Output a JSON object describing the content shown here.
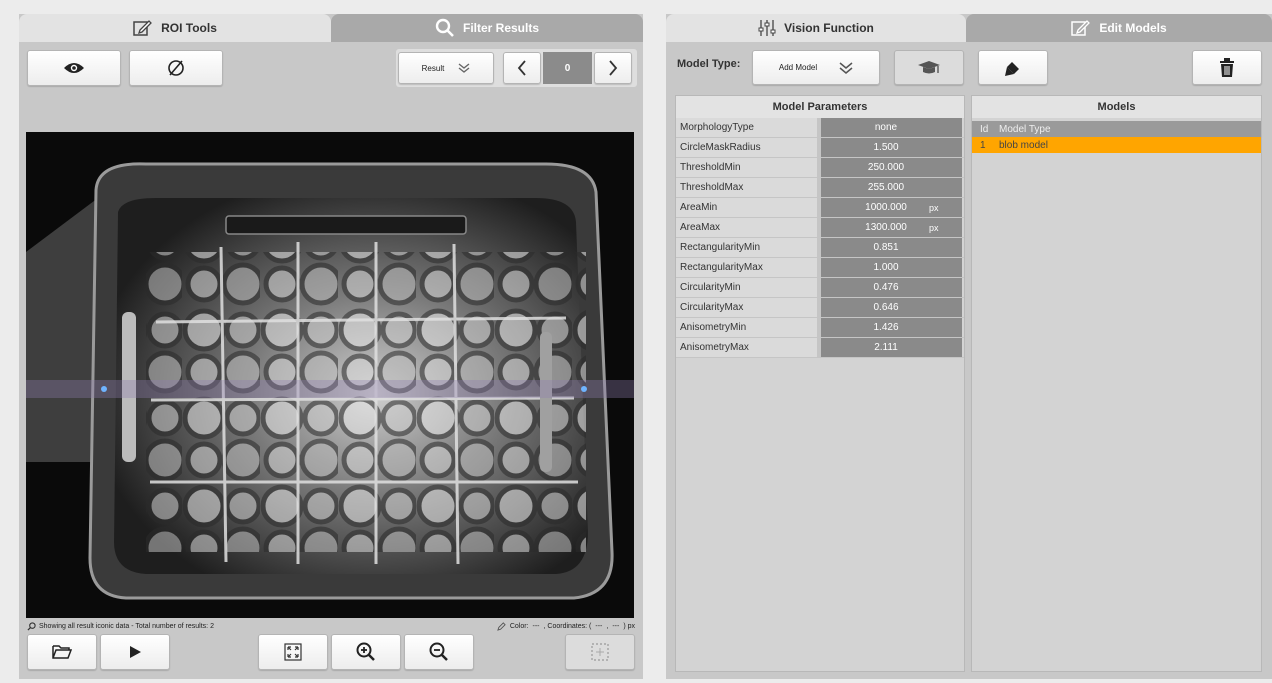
{
  "left_tabs": [
    {
      "label": "ROI Tools",
      "icon": "edit-icon",
      "active": true
    },
    {
      "label": "Filter Results",
      "icon": "search-icon",
      "active": false
    }
  ],
  "left_toolbar": {
    "show_icon": "eye-icon",
    "hide_icon": "eye-off-icon",
    "result_select": "Result",
    "result_index": "0"
  },
  "status": {
    "message": "Showing all result iconic data - Total number of results: 2",
    "color_label": "Color:",
    "color_value": "---",
    "coord_label": ", Coordinates: (",
    "coord_x": "---",
    "coord_sep": ",",
    "coord_y": "---",
    "coord_unit": ") px"
  },
  "bottom_toolbar": [
    "folder-open-icon",
    "play-icon",
    "fit-screen-icon",
    "zoom-in-icon",
    "zoom-out-icon",
    "selection-icon"
  ],
  "right_tabs": [
    {
      "label": "Vision Function",
      "icon": "sliders-icon",
      "active": true
    },
    {
      "label": "Edit Models",
      "icon": "edit-icon",
      "active": false
    }
  ],
  "model_type": {
    "label": "Model Type:",
    "select": "Add Model"
  },
  "params": {
    "title": "Model Parameters",
    "rows": [
      {
        "name": "MorphologyType",
        "value": "none",
        "unit": ""
      },
      {
        "name": "CircleMaskRadius",
        "value": "1.500",
        "unit": ""
      },
      {
        "name": "ThresholdMin",
        "value": "250.000",
        "unit": ""
      },
      {
        "name": "ThresholdMax",
        "value": "255.000",
        "unit": ""
      },
      {
        "name": "AreaMin",
        "value": "1000.000",
        "unit": "px"
      },
      {
        "name": "AreaMax",
        "value": "1300.000",
        "unit": "px"
      },
      {
        "name": "RectangularityMin",
        "value": "0.851",
        "unit": ""
      },
      {
        "name": "RectangularityMax",
        "value": "1.000",
        "unit": ""
      },
      {
        "name": "CircularityMin",
        "value": "0.476",
        "unit": ""
      },
      {
        "name": "CircularityMax",
        "value": "0.646",
        "unit": ""
      },
      {
        "name": "AnisometryMin",
        "value": "1.426",
        "unit": ""
      },
      {
        "name": "AnisometryMax",
        "value": "2.111",
        "unit": ""
      }
    ]
  },
  "models": {
    "title": "Models",
    "col_id": "Id",
    "col_type": "Model Type",
    "rows": [
      {
        "id": "1",
        "type": "blob model"
      }
    ]
  },
  "colors": {
    "accent_selected": "#ffa500",
    "panel": "#c8c8c8",
    "value_bg": "#8a8a8a"
  }
}
